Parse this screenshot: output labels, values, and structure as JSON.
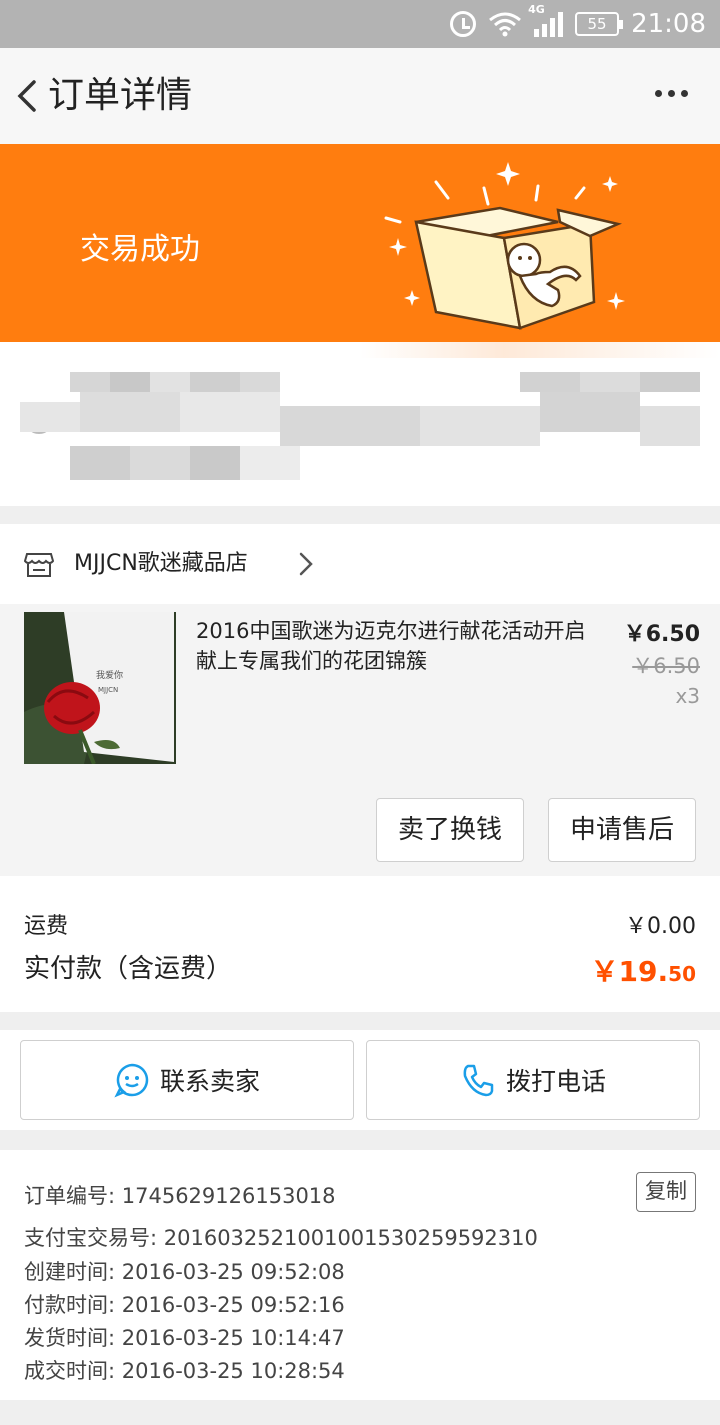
{
  "status_bar": {
    "battery": "55",
    "network": "4G",
    "time": "21:08"
  },
  "header": {
    "title": "订单详情"
  },
  "banner": {
    "status_text": "交易成功",
    "accent": "#ff7d0f"
  },
  "shop": {
    "name": "MJJCN歌迷藏品店"
  },
  "product": {
    "title": "2016中国歌迷为迈克尔进行献花活动开启 献上专属我们的花团锦簇",
    "price": "￥6.50",
    "original_price": "￥6.50",
    "quantity": "x3",
    "card_text_1": "我爱你",
    "card_text_2": "MJJCN"
  },
  "actions": {
    "sell_label": "卖了换钱",
    "after_sale_label": "申请售后"
  },
  "summary": {
    "shipping_label": "运费",
    "shipping_value": "￥0.00",
    "paid_label": "实付款（含运费）",
    "paid_value_main": "￥19.",
    "paid_value_cents": "50",
    "price_color": "#ff5000"
  },
  "contact": {
    "seller_label": "联系卖家",
    "call_label": "拨打电话"
  },
  "order_info": {
    "copy_label": "复制",
    "rows": [
      "订单编号: 1745629126153018",
      "支付宝交易号: 2016032521001001530259592310",
      "创建时间: 2016-03-25 09:52:08",
      "付款时间: 2016-03-25 09:52:16",
      "发货时间: 2016-03-25 10:14:47",
      "成交时间: 2016-03-25 10:28:54"
    ]
  }
}
